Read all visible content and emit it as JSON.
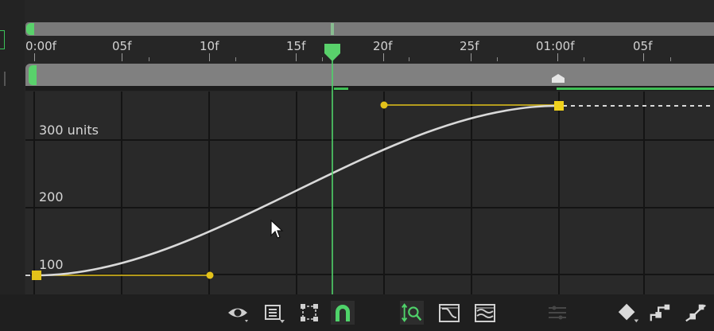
{
  "ruler": {
    "ticks": [
      "0:00f",
      "05f",
      "10f",
      "15f",
      "20f",
      "25f",
      "01:00f",
      "05f"
    ]
  },
  "graph": {
    "y_labels": [
      "300 units",
      "200",
      "100"
    ]
  },
  "toolbar": {
    "tools": [
      "eye-icon",
      "graph-type-menu-icon",
      "transform-box-icon",
      "snap-magnet-icon",
      "fit-selection-icon",
      "fit-all-graphs-icon",
      "fit-all-icon",
      "separate-dimensions-icon",
      "keyframe-diamond-icon",
      "hold-keyframe-icon",
      "easy-ease-icon"
    ]
  },
  "colors": {
    "accent_green": "#59d16b",
    "curve": "#d9d9d9",
    "handle_yellow": "#e3c21a",
    "background": "#262626"
  }
}
